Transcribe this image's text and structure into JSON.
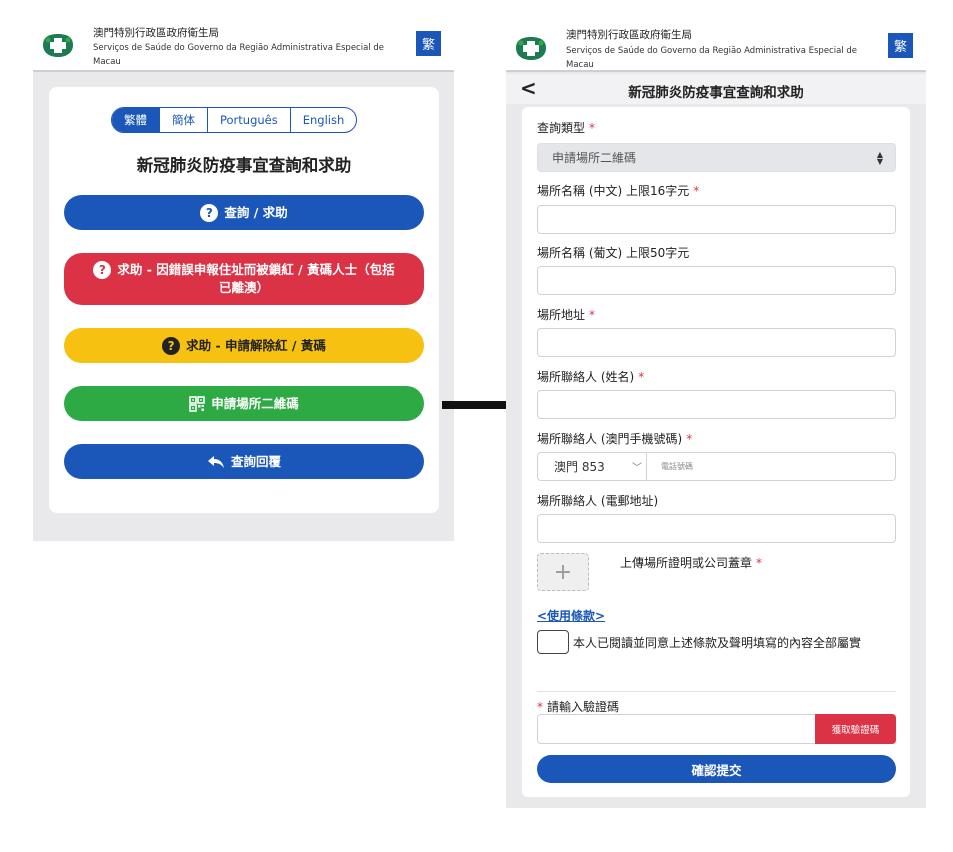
{
  "header": {
    "org_zh": "澳門特別行政區政府衛生局",
    "org_pt": "Serviços de Saúde do Governo da Região Administrativa Especial de Macau",
    "lang_button": "繁"
  },
  "left": {
    "languages": [
      "繁體",
      "簡体",
      "Português",
      "English"
    ],
    "title": "新冠肺炎防疫事宜查詢和求助",
    "buttons": {
      "inquiry": "查詢 / 求助",
      "wrong_address": "求助 - 因錯誤申報住址而被鎖紅 / 黃碼人士（包括已離澳）",
      "release": "求助 - 申請解除紅 / 黃碼",
      "qr_apply": "申請場所二維碼",
      "reply": "查詢回覆"
    }
  },
  "right": {
    "nav_title": "新冠肺炎防疫事宜查詢和求助",
    "back_glyph": "<",
    "form": {
      "type_label": "查詢類型",
      "type_value": "申請場所二維碼",
      "name_zh_label": "場所名稱 (中文) 上限16字元",
      "name_pt_label": "場所名稱 (葡文) 上限50字元",
      "address_label": "場所地址",
      "contact_name_label": "場所聯絡人 (姓名)",
      "contact_phone_label": "場所聯絡人 (澳門手機號碼)",
      "country_code": "澳門 853",
      "phone_placeholder": "電話號碼",
      "contact_email_label": "場所聯絡人 (電郵地址)",
      "upload_label": "上傳場所證明或公司蓋章",
      "upload_plus": "+",
      "terms_link": "<使用條款>",
      "agree_text": "本人已閱讀並同意上述條款及聲明填寫的內容全部屬實",
      "captcha_label": "請輸入驗證碼",
      "captcha_button": "獲取驗證碼",
      "submit": "確認提交",
      "required_mark": "*"
    }
  },
  "colors": {
    "primary": "#1a57b8",
    "danger": "#dc3246",
    "warning": "#f6c110",
    "success": "#2eaa45"
  },
  "icons": [
    "health-logo-icon",
    "question-circle-icon",
    "qr-code-icon",
    "reply-arrow-icon",
    "back-arrow-icon",
    "select-caret-icon",
    "chevron-down-icon",
    "plus-icon",
    "flow-arrow-icon"
  ]
}
